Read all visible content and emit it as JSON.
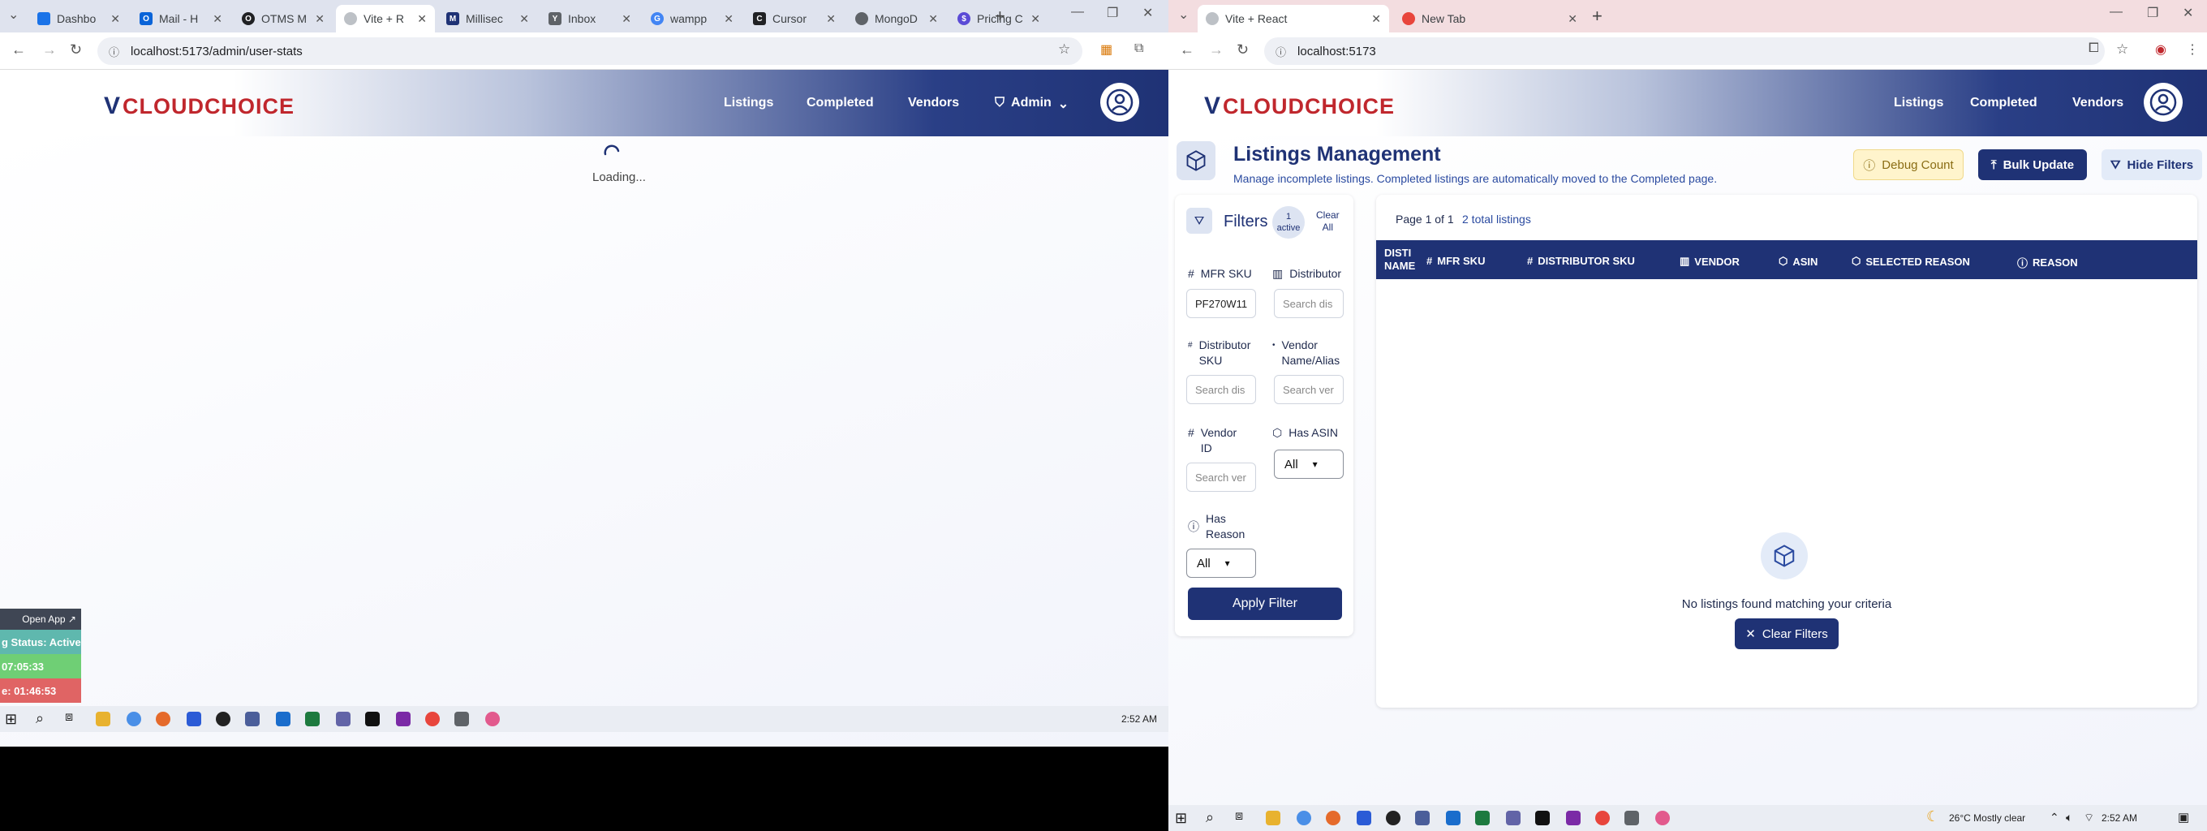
{
  "left": {
    "tabs": [
      {
        "title": "Dashbo",
        "favicon_color": "#1a73e8"
      },
      {
        "title": "Mail - H",
        "favicon_color": "#0a64d8"
      },
      {
        "title": "OTMS M",
        "favicon_color": "#202124"
      },
      {
        "title": "Vite + R",
        "favicon_color": "#bdc1c6"
      },
      {
        "title": "Millisec",
        "favicon_color": "#1f3275"
      },
      {
        "title": "Inbox",
        "favicon_color": "#5f6368"
      },
      {
        "title": "wampp",
        "favicon_color": "#4285f4"
      },
      {
        "title": "Cursor",
        "favicon_color": "#202124"
      },
      {
        "title": "MongoD",
        "favicon_color": "#5f6368"
      },
      {
        "title": "Pricing C",
        "favicon_color": "#5b4bd6"
      }
    ],
    "url": "localhost:5173/admin/user-stats",
    "nav": [
      "Listings",
      "Completed",
      "Vendors",
      "Admin"
    ],
    "loading_text": "Loading...",
    "widget": {
      "open_app": "Open App ↗",
      "status": "g Status: Active",
      "time1": "07:05:33",
      "time2": "e: 01:46:53"
    },
    "clock": "2:52 AM"
  },
  "right": {
    "tabs": [
      {
        "title": "Vite + React"
      },
      {
        "title": "New Tab"
      }
    ],
    "url": "localhost:5173",
    "nav": [
      "Listings",
      "Completed",
      "Vendors"
    ],
    "title": "Listings Management",
    "subtitle": "Manage incomplete listings. Completed listings are automatically moved to the Completed page.",
    "buttons": {
      "debug": "Debug Count",
      "bulk": "Bulk Update",
      "hide": "Hide Filters"
    },
    "filters": {
      "heading": "Filters",
      "active_num": "1",
      "active_word": "active",
      "clear_1": "Clear",
      "clear_2": "All",
      "mfr_sku_label": "MFR SKU",
      "mfr_sku_value": "PF270W11",
      "distributor_label": "Distributor",
      "distributor_placeholder": "Search dis",
      "dist_sku_label_1": "Distributor",
      "dist_sku_label_2": "SKU",
      "dist_sku_placeholder": "Search dis",
      "vendor_name_label_1": "Vendor",
      "vendor_name_label_2": "Name/Alias",
      "vendor_name_placeholder": "Search ver",
      "vendor_id_label_1": "Vendor",
      "vendor_id_label_2": "ID",
      "vendor_id_placeholder": "Search ver",
      "has_asin_label": "Has ASIN",
      "has_asin_value": "All",
      "has_reason_label_1": "Has",
      "has_reason_label_2": "Reason",
      "has_reason_value": "All",
      "apply": "Apply Filter"
    },
    "page_info": "Page 1 of 1",
    "total": "2 total listings",
    "columns": {
      "c1a": "DISTI",
      "c1b": "NAME",
      "c2": "MFR SKU",
      "c3": "DISTRIBUTOR SKU",
      "c4": "VENDOR",
      "c5": "ASIN",
      "c6": "SELECTED REASON",
      "c7": "REASON"
    },
    "empty_text": "No listings found matching your criteria",
    "clear_filters": "Clear Filters",
    "weather": "26°C  Mostly clear",
    "clock": "2:52 AM"
  },
  "colors": {
    "brand": "#1f3275",
    "logo_red": "#c0272d",
    "debug_bg": "#fff4cc",
    "hide_bg": "#e3ebf8"
  }
}
